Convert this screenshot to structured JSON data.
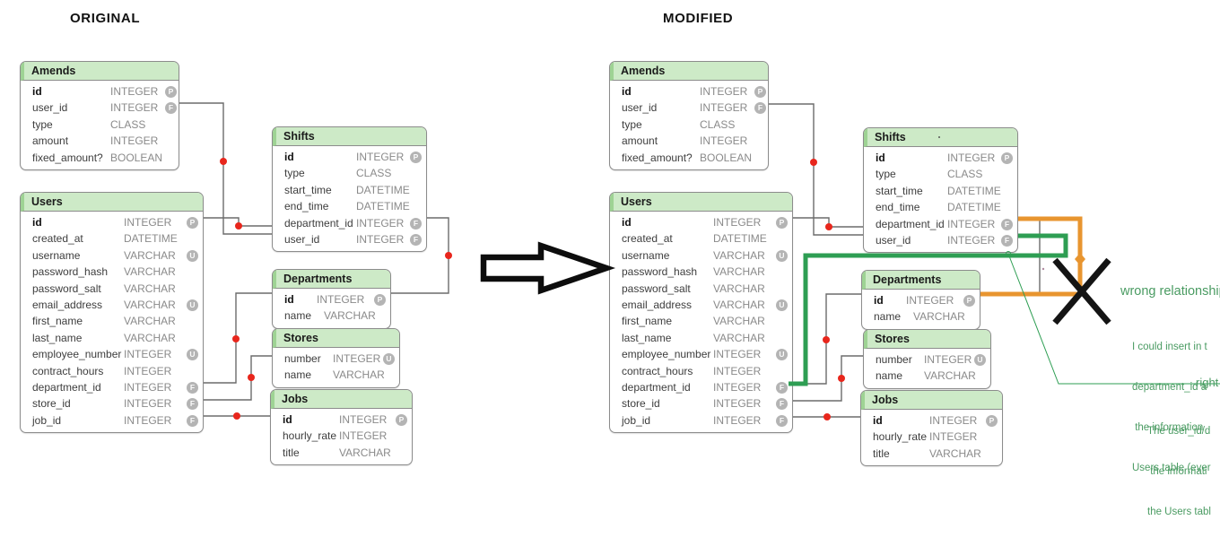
{
  "panels": {
    "left_title": "ORIGINAL",
    "right_title": "MODIFIED"
  },
  "colors": {
    "header_fill": "#cdeac7",
    "header_accent": "#9ed394",
    "table_border": "#8c8c8c",
    "connector": "#6b6b6b",
    "connector_dot": "#e8261c",
    "overlay_green": "#2e9e53",
    "overlay_orange": "#e8952f",
    "annotation_green": "#4a9b62",
    "cross_mark": "#141414",
    "type_text": "#8a8a8a",
    "badge_fill": "#b4b4b4"
  },
  "tables": {
    "amends": {
      "name": "Amends",
      "columns": [
        {
          "name": "id",
          "type": "INTEGER",
          "key": "P"
        },
        {
          "name": "user_id",
          "type": "INTEGER",
          "key": "F"
        },
        {
          "name": "type",
          "type": "CLASS",
          "key": ""
        },
        {
          "name": "amount",
          "type": "INTEGER",
          "key": ""
        },
        {
          "name": "fixed_amount?",
          "type": "BOOLEAN",
          "key": ""
        }
      ]
    },
    "users": {
      "name": "Users",
      "columns": [
        {
          "name": "id",
          "type": "INTEGER",
          "key": "P"
        },
        {
          "name": "created_at",
          "type": "DATETIME",
          "key": ""
        },
        {
          "name": "username",
          "type": "VARCHAR",
          "key": "U"
        },
        {
          "name": "password_hash",
          "type": "VARCHAR",
          "key": ""
        },
        {
          "name": "password_salt",
          "type": "VARCHAR",
          "key": ""
        },
        {
          "name": "email_address",
          "type": "VARCHAR",
          "key": "U"
        },
        {
          "name": "first_name",
          "type": "VARCHAR",
          "key": ""
        },
        {
          "name": "last_name",
          "type": "VARCHAR",
          "key": ""
        },
        {
          "name": "employee_number",
          "type": "INTEGER",
          "key": "U"
        },
        {
          "name": "contract_hours",
          "type": "INTEGER",
          "key": ""
        },
        {
          "name": "department_id",
          "type": "INTEGER",
          "key": "F"
        },
        {
          "name": "store_id",
          "type": "INTEGER",
          "key": "F"
        },
        {
          "name": "job_id",
          "type": "INTEGER",
          "key": "F"
        }
      ]
    },
    "shifts": {
      "name": "Shifts",
      "columns": [
        {
          "name": "id",
          "type": "INTEGER",
          "key": "P"
        },
        {
          "name": "type",
          "type": "CLASS",
          "key": ""
        },
        {
          "name": "start_time",
          "type": "DATETIME",
          "key": ""
        },
        {
          "name": "end_time",
          "type": "DATETIME",
          "key": ""
        },
        {
          "name": "department_id",
          "type": "INTEGER",
          "key": "F"
        },
        {
          "name": "user_id",
          "type": "INTEGER",
          "key": "F"
        }
      ]
    },
    "departments": {
      "name": "Departments",
      "columns": [
        {
          "name": "id",
          "type": "INTEGER",
          "key": "P"
        },
        {
          "name": "name",
          "type": "VARCHAR",
          "key": ""
        }
      ]
    },
    "stores": {
      "name": "Stores",
      "columns": [
        {
          "name": "number",
          "type": "INTEGER",
          "key": "U"
        },
        {
          "name": "name",
          "type": "VARCHAR",
          "key": ""
        }
      ]
    },
    "jobs": {
      "name": "Jobs",
      "columns": [
        {
          "name": "id",
          "type": "INTEGER",
          "key": "P"
        },
        {
          "name": "hourly_rate",
          "type": "INTEGER",
          "key": ""
        },
        {
          "name": "title",
          "type": "VARCHAR",
          "key": ""
        }
      ]
    }
  },
  "annotations": {
    "wrong_relationship": "wrong relationship?",
    "right_label": "right",
    "note_wrong_lines": [
      "I could insert in t",
      "department_id a",
      " the information",
      "Users table (ever"
    ],
    "note_right_lines": [
      "The user_id/d",
      " the informati",
      "the Users tabl"
    ]
  },
  "icons": {
    "flow_arrow": "block-arrow-right",
    "cross": "x-cross-mark",
    "primary_key": "P",
    "foreign_key": "F",
    "unique_key": "U"
  }
}
